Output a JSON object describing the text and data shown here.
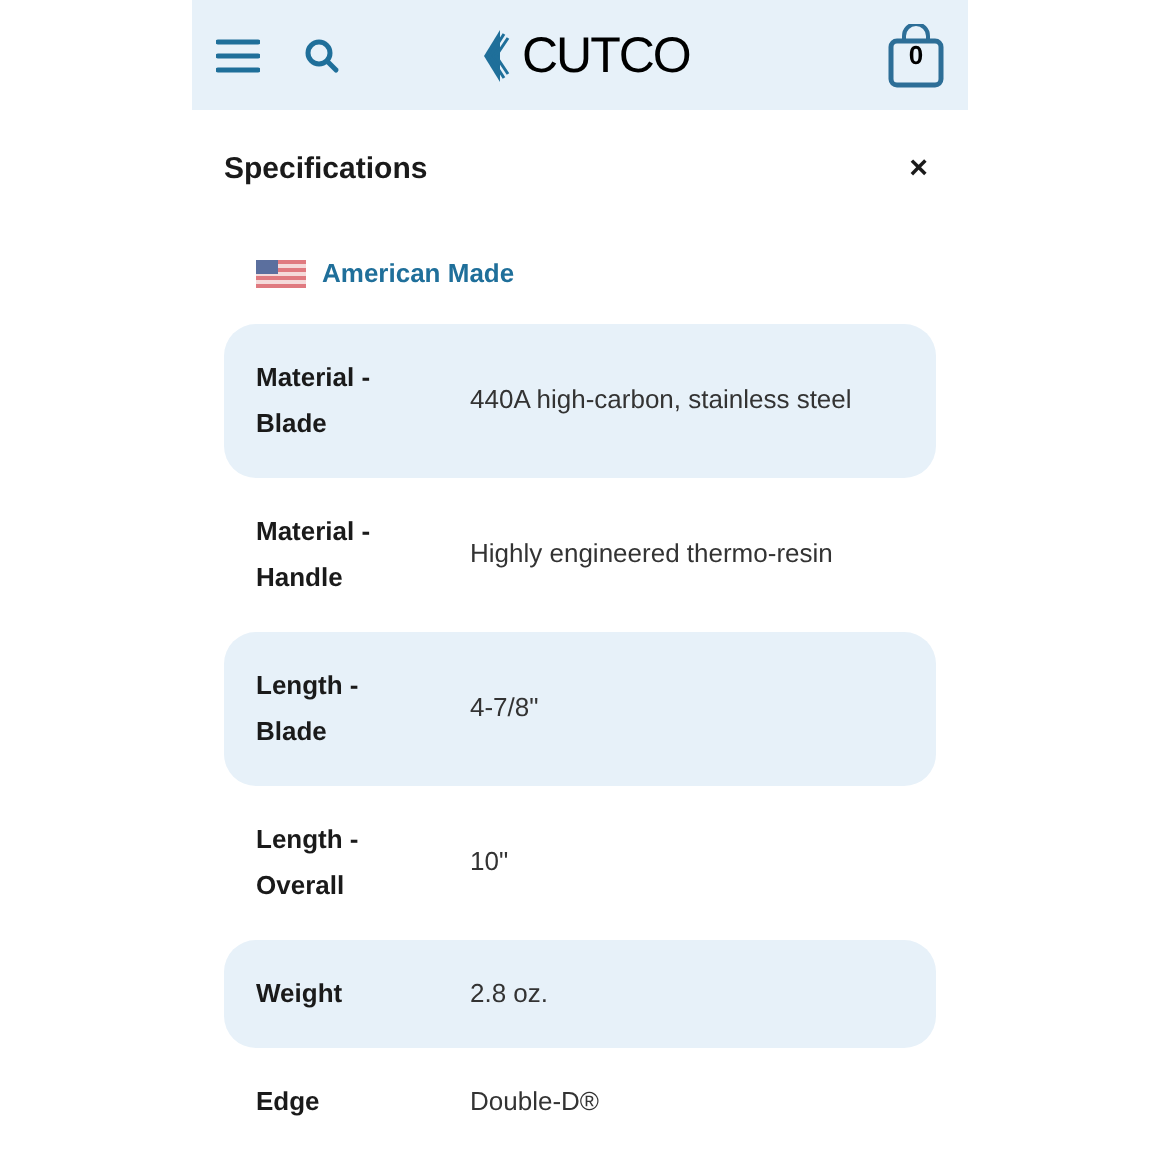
{
  "header": {
    "logo": "CUTCO",
    "cart_count": "0"
  },
  "panel": {
    "title": "Specifications",
    "close": "×"
  },
  "badge": {
    "label": "American Made"
  },
  "specs": [
    {
      "label": "Material - Blade",
      "value": "440A high-carbon, stainless steel"
    },
    {
      "label": "Material - Handle",
      "value": "Highly engineered thermo-resin"
    },
    {
      "label": "Length - Blade",
      "value": "4-7/8\""
    },
    {
      "label": "Length - Overall",
      "value": "10\""
    },
    {
      "label": "Weight",
      "value": "2.8 oz."
    },
    {
      "label": "Edge",
      "value": "Double-D®"
    }
  ]
}
